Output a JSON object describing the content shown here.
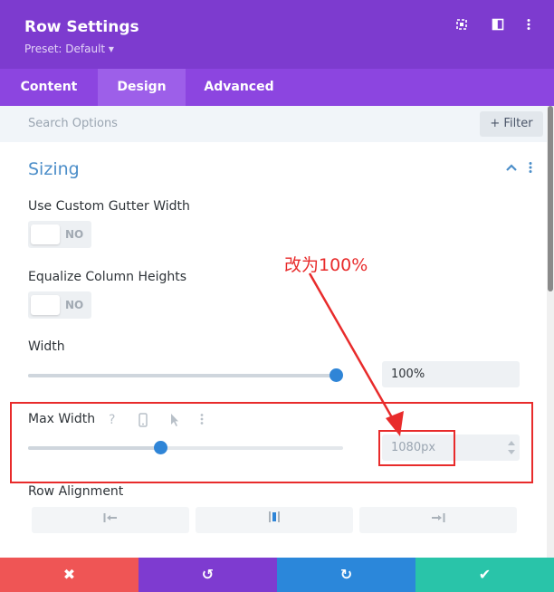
{
  "header": {
    "title": "Row Settings",
    "preset": "Preset: Default ▾",
    "icons": [
      "expand-icon",
      "split-view-icon",
      "more-icon"
    ]
  },
  "tabs": [
    {
      "label": "Content"
    },
    {
      "label": "Design",
      "active": true
    },
    {
      "label": "Advanced"
    }
  ],
  "search": {
    "placeholder": "Search Options",
    "filter_label": "Filter",
    "filter_glyph": "+"
  },
  "section": {
    "title": "Sizing"
  },
  "fields": {
    "gutter": {
      "label": "Use Custom Gutter Width",
      "value": "NO"
    },
    "equalize": {
      "label": "Equalize Column Heights",
      "value": "NO"
    },
    "width": {
      "label": "Width",
      "value": "100%",
      "slider_fraction": 1.0
    },
    "max_width": {
      "label": "Max Width",
      "value": "1080px",
      "slider_fraction": 0.42
    },
    "row_alignment": {
      "label": "Row Alignment",
      "options": [
        "align-left-icon",
        "align-center-icon",
        "align-right-icon"
      ]
    }
  },
  "annotation": {
    "text": "改为100%",
    "color": "#e82b2b"
  },
  "footer": {
    "buttons": [
      {
        "name": "cancel",
        "glyph": "✖",
        "color": "#ef5555"
      },
      {
        "name": "undo",
        "glyph": "↺",
        "color": "#7e3bd0"
      },
      {
        "name": "redo",
        "glyph": "↻",
        "color": "#2b87da"
      },
      {
        "name": "save",
        "glyph": "✔",
        "color": "#29c4a9"
      }
    ]
  },
  "colors": {
    "header": "#7d3bcf",
    "accent_blue": "#2f85d7",
    "section_title": "#4c8ec9"
  }
}
